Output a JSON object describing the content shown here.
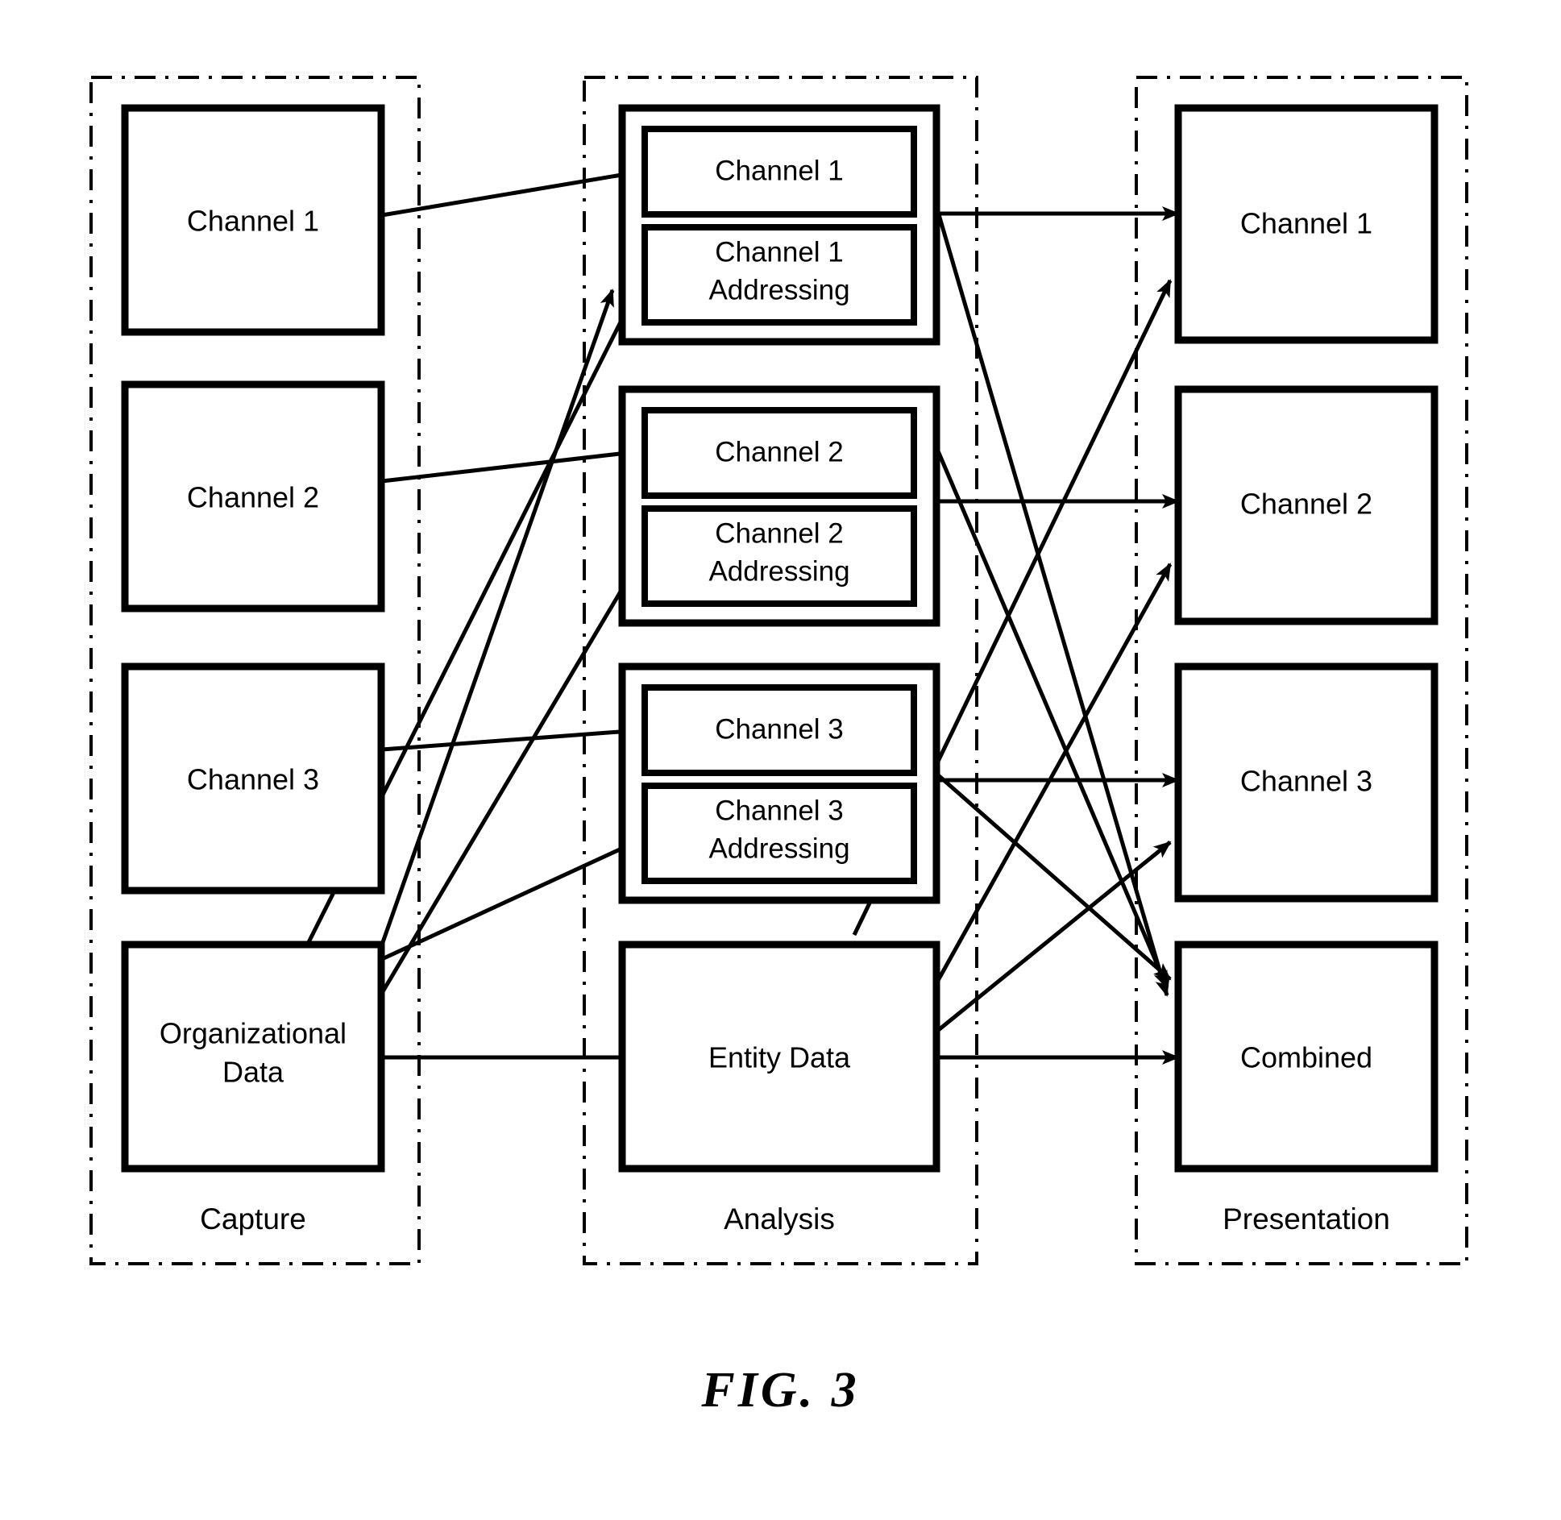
{
  "figure": {
    "caption": "FIG. 3"
  },
  "zones": [
    {
      "id": "capture",
      "label": "Capture"
    },
    {
      "id": "analysis",
      "label": "Analysis"
    },
    {
      "id": "presentation",
      "label": "Presentation"
    }
  ],
  "capture": {
    "boxes": [
      {
        "id": "capture-channel-1",
        "label": "Channel 1"
      },
      {
        "id": "capture-channel-2",
        "label": "Channel 2"
      },
      {
        "id": "capture-channel-3",
        "label": "Channel 3"
      },
      {
        "id": "capture-organizational-data",
        "label_line1": "Organizational",
        "label_line2": "Data"
      }
    ]
  },
  "analysis": {
    "groups": [
      {
        "id": "analysis-group-1",
        "channel_label": "Channel 1",
        "addressing_line1": "Channel 1",
        "addressing_line2": "Addressing"
      },
      {
        "id": "analysis-group-2",
        "channel_label": "Channel 2",
        "addressing_line1": "Channel 2",
        "addressing_line2": "Addressing"
      },
      {
        "id": "analysis-group-3",
        "channel_label": "Channel 3",
        "addressing_line1": "Channel 3",
        "addressing_line2": "Addressing"
      }
    ],
    "entity_data": {
      "id": "analysis-entity-data",
      "label": "Entity Data"
    }
  },
  "presentation": {
    "boxes": [
      {
        "id": "presentation-channel-1",
        "label": "Channel 1"
      },
      {
        "id": "presentation-channel-2",
        "label": "Channel 2"
      },
      {
        "id": "presentation-channel-3",
        "label": "Channel 3"
      },
      {
        "id": "presentation-combined",
        "label": "Combined"
      }
    ]
  },
  "colors": {
    "stroke": "#000000",
    "background": "#ffffff"
  }
}
